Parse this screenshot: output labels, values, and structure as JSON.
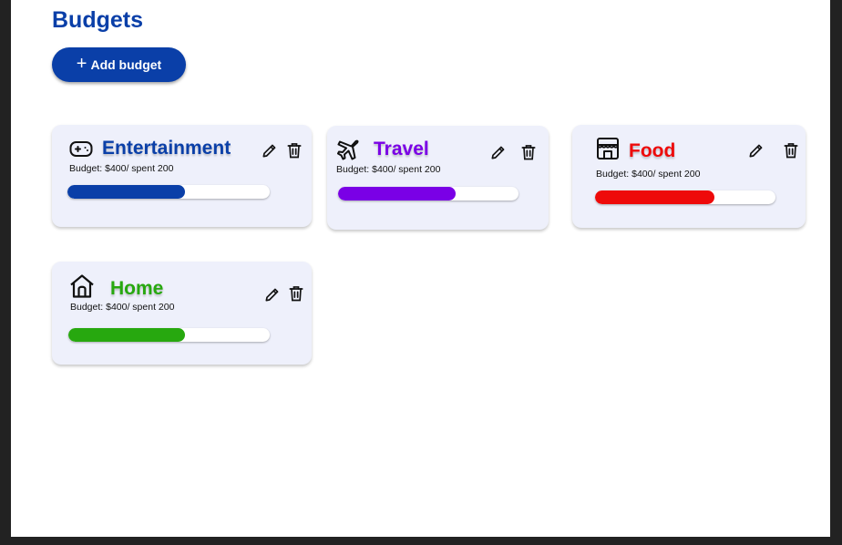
{
  "page": {
    "title": "Budgets"
  },
  "add_button": {
    "icon": "plus-icon",
    "label": "Add budget"
  },
  "colors": {
    "brand": "#0a3fa8",
    "entertainment": "#0a3fa8",
    "travel": "#7a00e6",
    "food": "#ee0a0a",
    "home": "#27a80f",
    "card_bg": "#eef0fb",
    "page_bg": "#ffffff"
  },
  "budgets": [
    {
      "name": "Entertainment",
      "icon": "gamepad-icon",
      "subtitle": "Budget: $400/ spent 200",
      "progress": 0.58,
      "color": "#0a3fa8"
    },
    {
      "name": "Travel",
      "icon": "airplane-icon",
      "subtitle": "Budget: $400/ spent 200",
      "progress": 0.65,
      "color": "#7a00e6"
    },
    {
      "name": "Food",
      "icon": "storefront-icon",
      "subtitle": "Budget: $400/ spent 200",
      "progress": 0.66,
      "color": "#ee0a0a"
    },
    {
      "name": "Home",
      "icon": "house-icon",
      "subtitle": "Budget: $400/ spent 200",
      "progress": 0.58,
      "color": "#27a80f"
    }
  ],
  "actions": {
    "edit_icon": "pencil-icon",
    "delete_icon": "trash-icon"
  }
}
